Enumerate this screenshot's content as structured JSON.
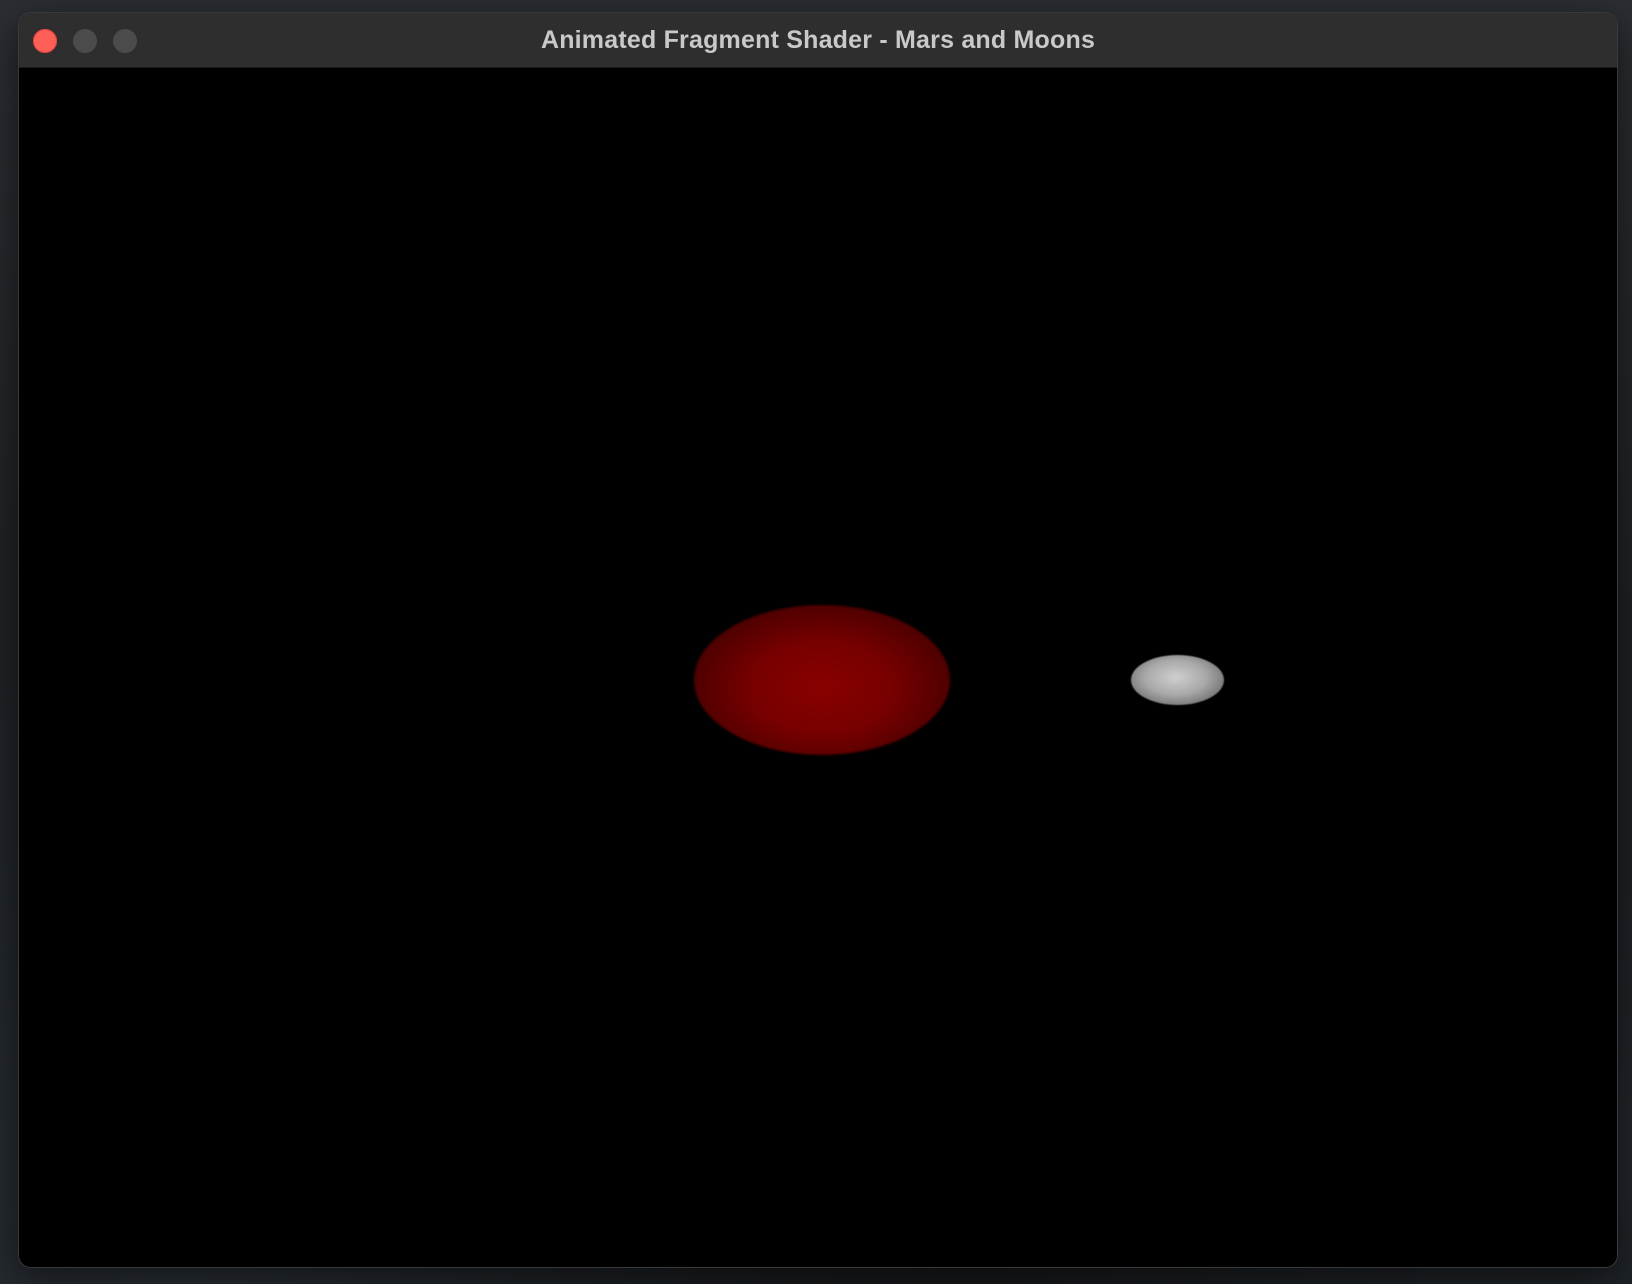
{
  "window": {
    "title": "Animated Fragment Shader - Mars and Moons"
  },
  "scene": {
    "background_color": "#000000",
    "mars_color": "#8a0000",
    "moon_color": "#c8c8c8"
  },
  "controls": {
    "close_color": "#fe5f57",
    "inactive_color": "#4b4b4b"
  }
}
